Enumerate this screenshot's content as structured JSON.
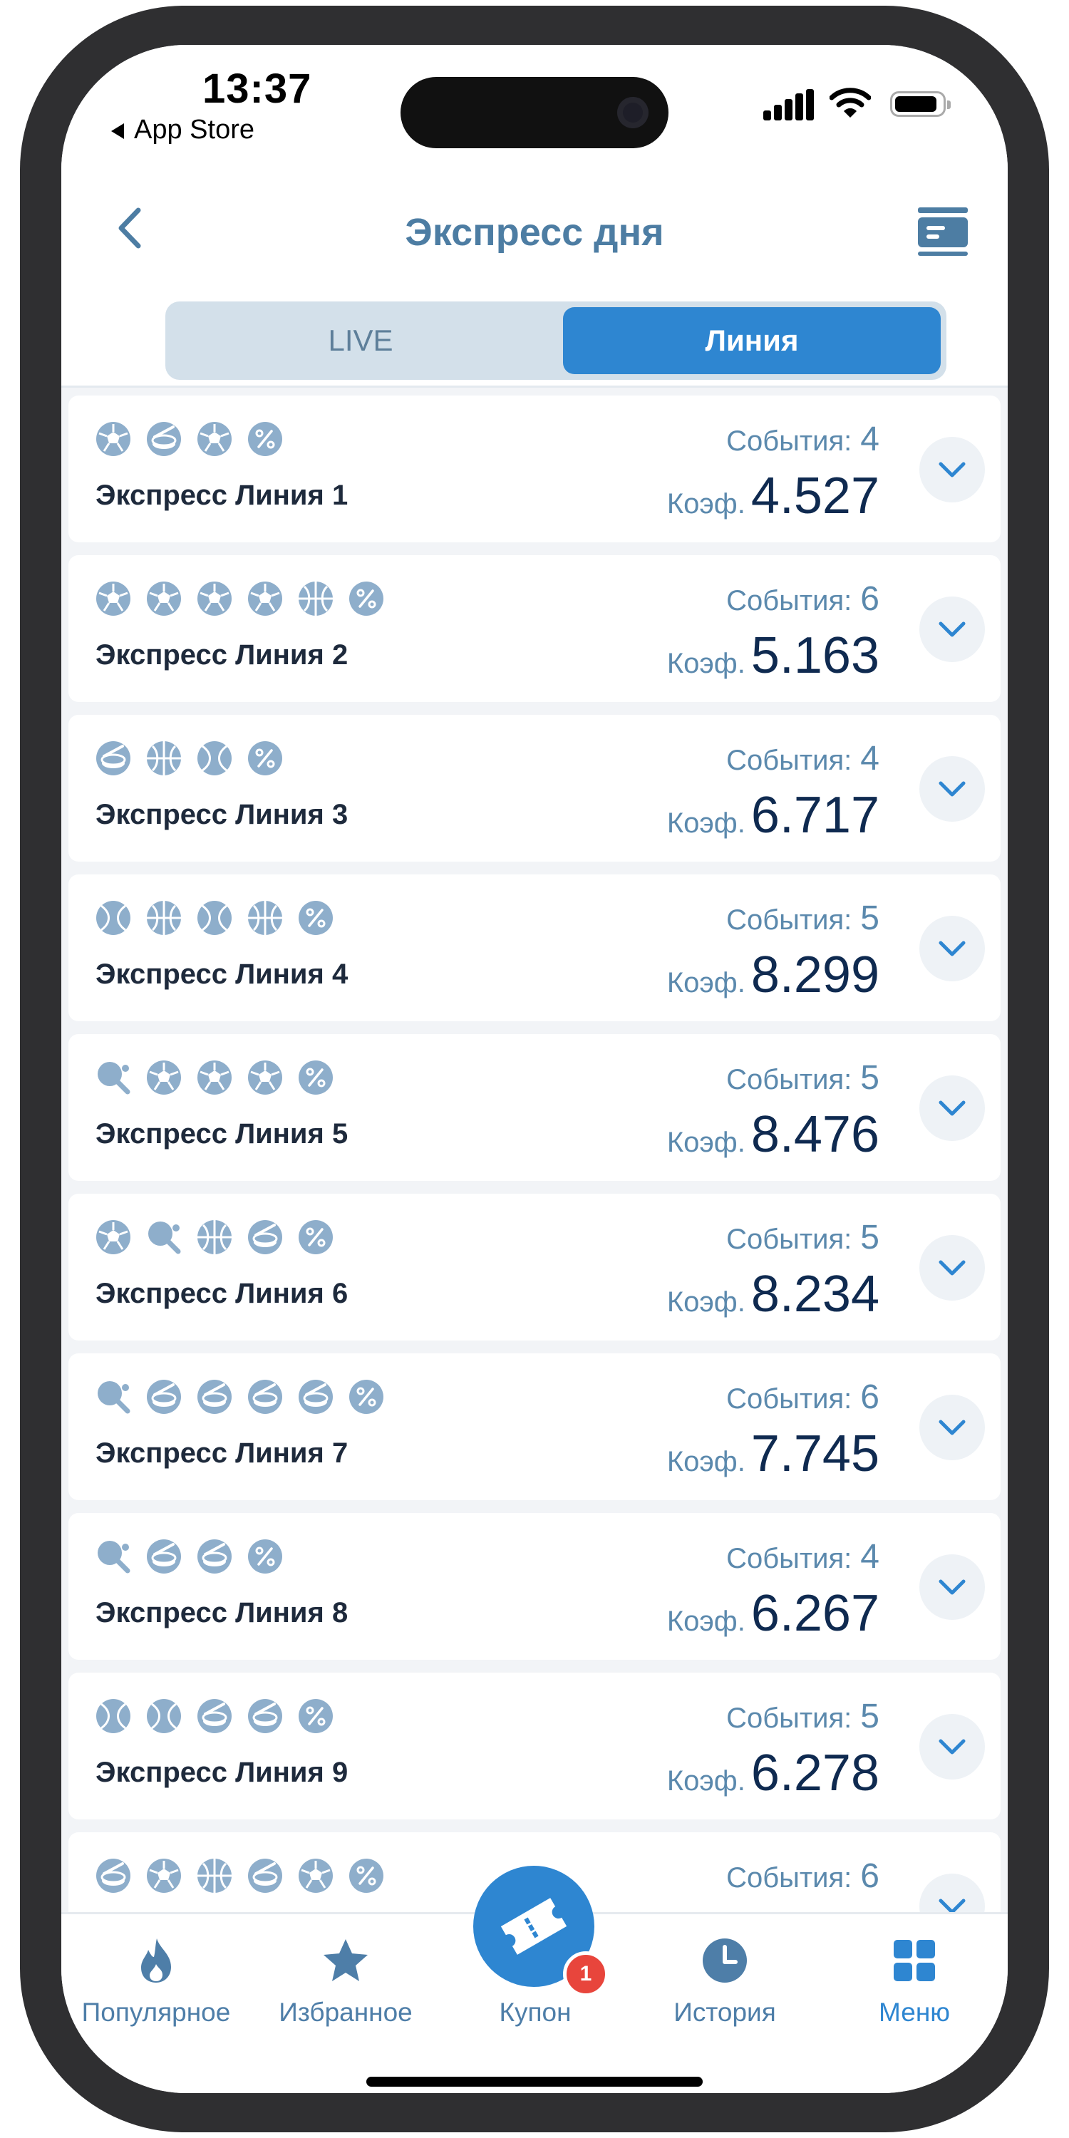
{
  "status": {
    "time": "13:37",
    "back_app": "App Store"
  },
  "header": {
    "title": "Экспресс дня"
  },
  "segments": {
    "live": "LIVE",
    "line": "Линия",
    "selected": "line"
  },
  "labels": {
    "events": "События:",
    "coef": "Коэф."
  },
  "colors": {
    "accent": "#2e86d1",
    "title": "#4d7da3",
    "badge": "#e8453c",
    "icon": "#8eaecb"
  },
  "expresses": [
    {
      "name": "Экспресс Линия 1",
      "events": "4",
      "coef": "4.527",
      "sports": [
        "soccer",
        "hockey",
        "soccer",
        "bonus"
      ]
    },
    {
      "name": "Экспресс Линия 2",
      "events": "6",
      "coef": "5.163",
      "sports": [
        "soccer",
        "soccer",
        "soccer",
        "soccer",
        "basketball",
        "bonus"
      ]
    },
    {
      "name": "Экспресс Линия 3",
      "events": "4",
      "coef": "6.717",
      "sports": [
        "hockey",
        "basketball",
        "tennis",
        "bonus"
      ]
    },
    {
      "name": "Экспресс Линия 4",
      "events": "5",
      "coef": "8.299",
      "sports": [
        "tennis",
        "basketball",
        "tennis",
        "basketball",
        "bonus"
      ]
    },
    {
      "name": "Экспресс Линия 5",
      "events": "5",
      "coef": "8.476",
      "sports": [
        "pingpong",
        "soccer",
        "soccer",
        "soccer",
        "bonus"
      ]
    },
    {
      "name": "Экспресс Линия 6",
      "events": "5",
      "coef": "8.234",
      "sports": [
        "soccer",
        "pingpong",
        "basketball",
        "hockey",
        "bonus"
      ]
    },
    {
      "name": "Экспресс Линия 7",
      "events": "6",
      "coef": "7.745",
      "sports": [
        "pingpong",
        "hockey",
        "hockey",
        "hockey",
        "hockey",
        "bonus"
      ]
    },
    {
      "name": "Экспресс Линия 8",
      "events": "4",
      "coef": "6.267",
      "sports": [
        "pingpong",
        "hockey",
        "hockey",
        "bonus"
      ]
    },
    {
      "name": "Экспресс Линия 9",
      "events": "5",
      "coef": "6.278",
      "sports": [
        "tennis",
        "tennis",
        "hockey",
        "hockey",
        "bonus"
      ]
    },
    {
      "name": "",
      "events": "6",
      "coef": "",
      "sports": [
        "hockey",
        "soccer",
        "basketball",
        "hockey",
        "soccer",
        "bonus"
      ]
    }
  ],
  "tabbar": {
    "popular": "Популярное",
    "favorites": "Избранное",
    "coupon": "Купон",
    "coupon_count": "1",
    "history": "История",
    "menu": "Меню"
  }
}
